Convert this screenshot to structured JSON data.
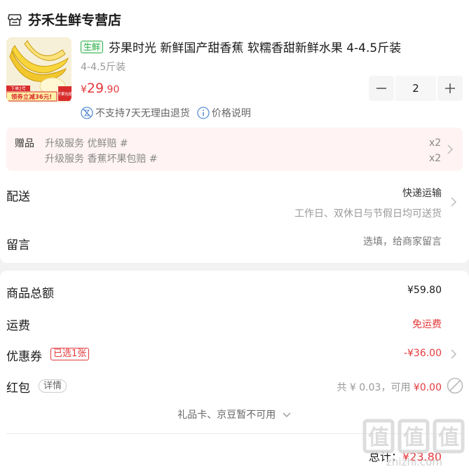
{
  "shop": {
    "name": "芬禾生鲜专营店",
    "icon": "shop-icon"
  },
  "product": {
    "tag": "生鲜",
    "title": "芬果时光 新鲜国产甜香蕉 软糯香甜新鲜水果 4-4.5斤装",
    "spec": "4-4.5斤装",
    "price_currency": "¥",
    "price_int": "29",
    "price_dec": ".90",
    "quantity": "2",
    "thumb_badge_left": "领券立减36元!",
    "thumb_badge_top": "下单2号",
    "thumb_badge_right": "坏果包赔",
    "notice_no_return": "不支持7天无理由退货",
    "notice_price": "价格说明"
  },
  "gifts": {
    "label": "赠品",
    "items": [
      {
        "name": "升级服务 优鲜赔 #",
        "qty": "x2"
      },
      {
        "name": "升级服务 香蕉坏果包赔 #",
        "qty": "x2"
      }
    ]
  },
  "delivery": {
    "label": "配送",
    "method": "快递运输",
    "note": "工作日、双休日与节假日均可送货"
  },
  "message": {
    "label": "留言",
    "placeholder": "选填，给商家留言"
  },
  "summary": {
    "goods_total_label": "商品总额",
    "goods_total": "¥59.80",
    "shipping_label": "运费",
    "shipping": "免运费",
    "coupon_label": "优惠券",
    "coupon_badge": "已选1张",
    "coupon_value": "-¥36.00",
    "redpacket_label": "红包",
    "redpacket_detail": "详情",
    "redpacket_available_prefix": "共 ¥ 0.03，可用 ",
    "redpacket_used": "¥0.00",
    "giftcard_note": "礼品卡、京豆暂不可用",
    "total_label": "总计：",
    "total_value": "¥23.80"
  },
  "watermark": {
    "text": "值",
    "site": "zhizhi.com"
  },
  "colors": {
    "accent": "#e4393c",
    "green": "#2fae4b",
    "gift_bg": "#fff3f3"
  }
}
